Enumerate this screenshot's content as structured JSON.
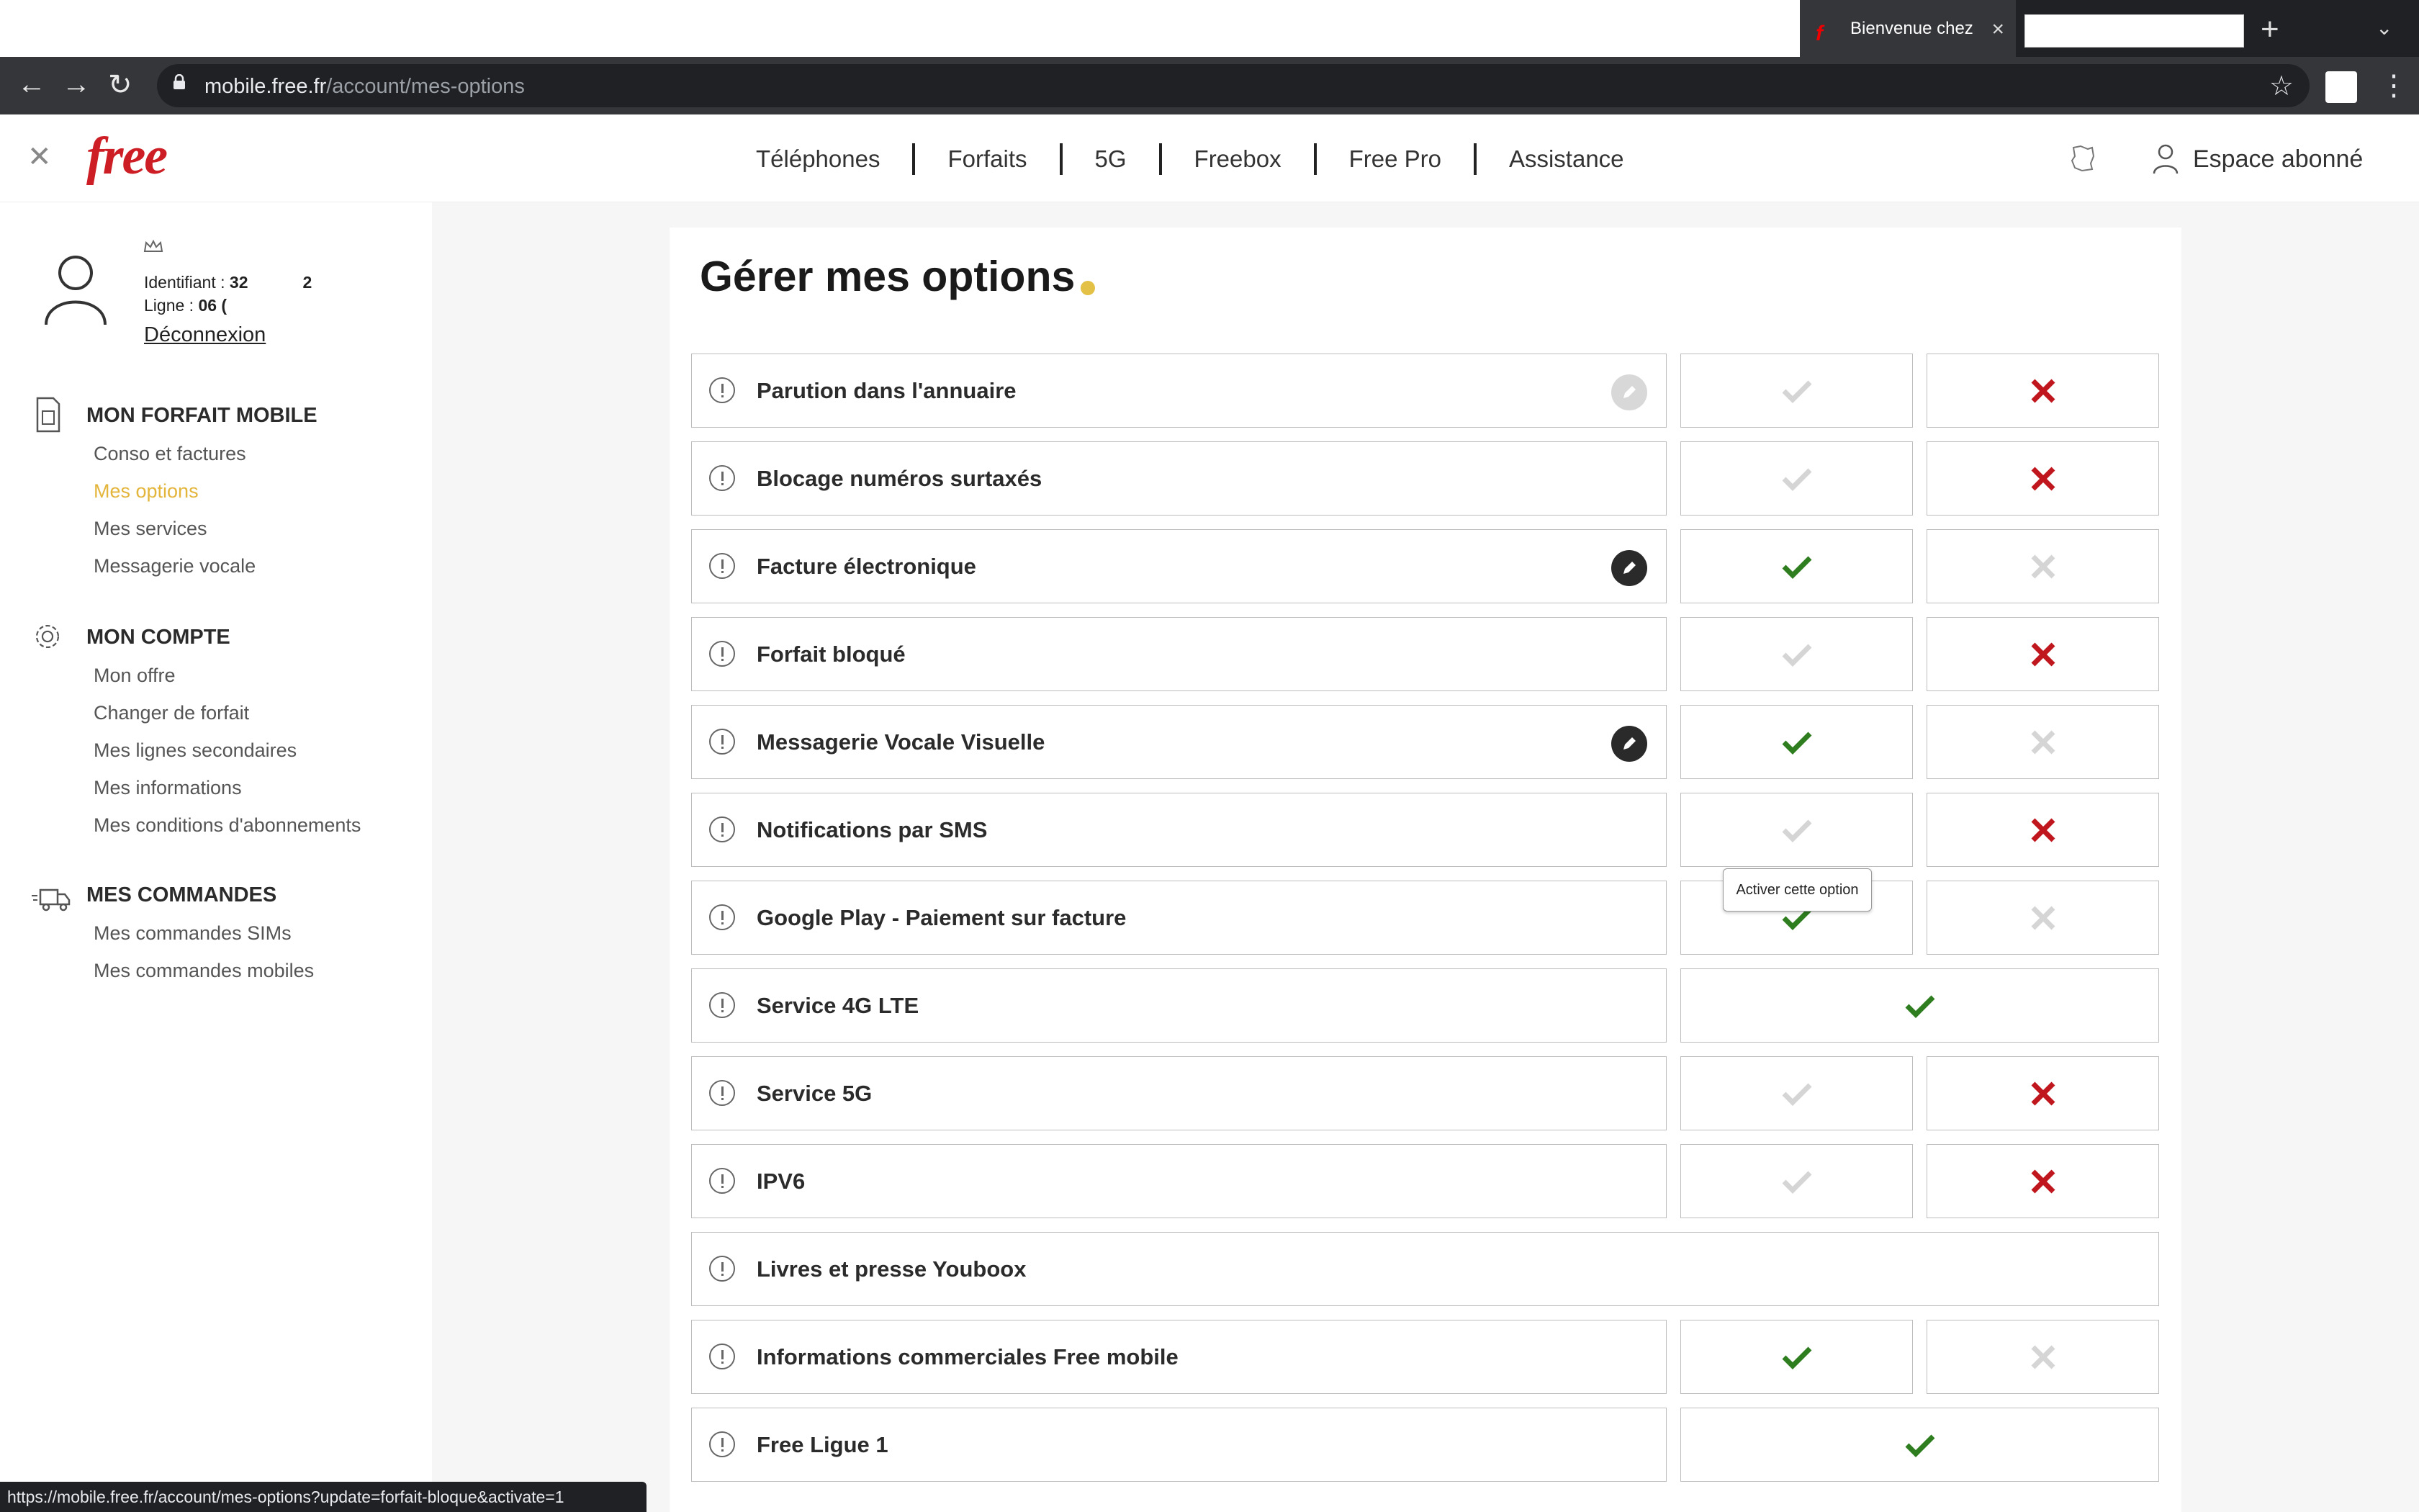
{
  "browser": {
    "tab_title": "Bienvenue chez",
    "url_host": "mobile.free.fr",
    "url_path": "/account/mes-options",
    "status_url": "https://mobile.free.fr/account/mes-options?update=forfait-bloque&activate=1"
  },
  "header": {
    "logo": "free",
    "nav": [
      "Téléphones",
      "Forfaits",
      "5G",
      "Freebox",
      "Free Pro",
      "Assistance"
    ],
    "account_label": "Espace abonné"
  },
  "profile": {
    "identifiant_label": "Identifiant :",
    "identifiant_value": "32",
    "identifiant_extra": "2",
    "ligne_label": "Ligne :",
    "ligne_value": "06 (",
    "logout": "Déconnexion"
  },
  "sidebar": {
    "sections": [
      {
        "title": "MON FORFAIT MOBILE",
        "items": [
          "Conso et factures",
          "Mes options",
          "Mes services",
          "Messagerie vocale"
        ]
      },
      {
        "title": "MON COMPTE",
        "items": [
          "Mon offre",
          "Changer de forfait",
          "Mes lignes secondaires",
          "Mes informations",
          "Mes conditions d'abonnements"
        ]
      },
      {
        "title": "MES COMMANDES",
        "items": [
          "Mes commandes SIMs",
          "Mes commandes mobiles"
        ]
      }
    ],
    "active_item": "Mes options"
  },
  "main": {
    "title": "Gérer mes options",
    "tooltip": "Activer cette option",
    "options": [
      {
        "label": "Parution dans l'annuaire",
        "edit": "disabled",
        "state": "inactive"
      },
      {
        "label": "Blocage numéros surtaxés",
        "edit": "none",
        "state": "inactive"
      },
      {
        "label": "Facture électronique",
        "edit": "enabled",
        "state": "active"
      },
      {
        "label": "Forfait bloqué",
        "edit": "none",
        "state": "inactive"
      },
      {
        "label": "Messagerie Vocale Visuelle",
        "edit": "enabled",
        "state": "active"
      },
      {
        "label": "Notifications par SMS",
        "edit": "none",
        "state": "inactive"
      },
      {
        "label": "Google Play - Paiement sur facture",
        "edit": "none",
        "state": "active"
      },
      {
        "label": "Service 4G LTE",
        "edit": "none",
        "state": "included"
      },
      {
        "label": "Service 5G",
        "edit": "none",
        "state": "inactive"
      },
      {
        "label": "IPV6",
        "edit": "none",
        "state": "inactive"
      },
      {
        "label": "Livres et presse Youboox",
        "edit": "none",
        "state": "none"
      },
      {
        "label": "Informations commerciales Free mobile",
        "edit": "none",
        "state": "active"
      },
      {
        "label": "Free Ligue 1",
        "edit": "none",
        "state": "included"
      }
    ]
  },
  "colors": {
    "brand": "#cd1e25",
    "active_link": "#e3b53b",
    "check_on": "#2e7d1e",
    "cross_on": "#c0161d",
    "off": "#d5d5d5"
  }
}
